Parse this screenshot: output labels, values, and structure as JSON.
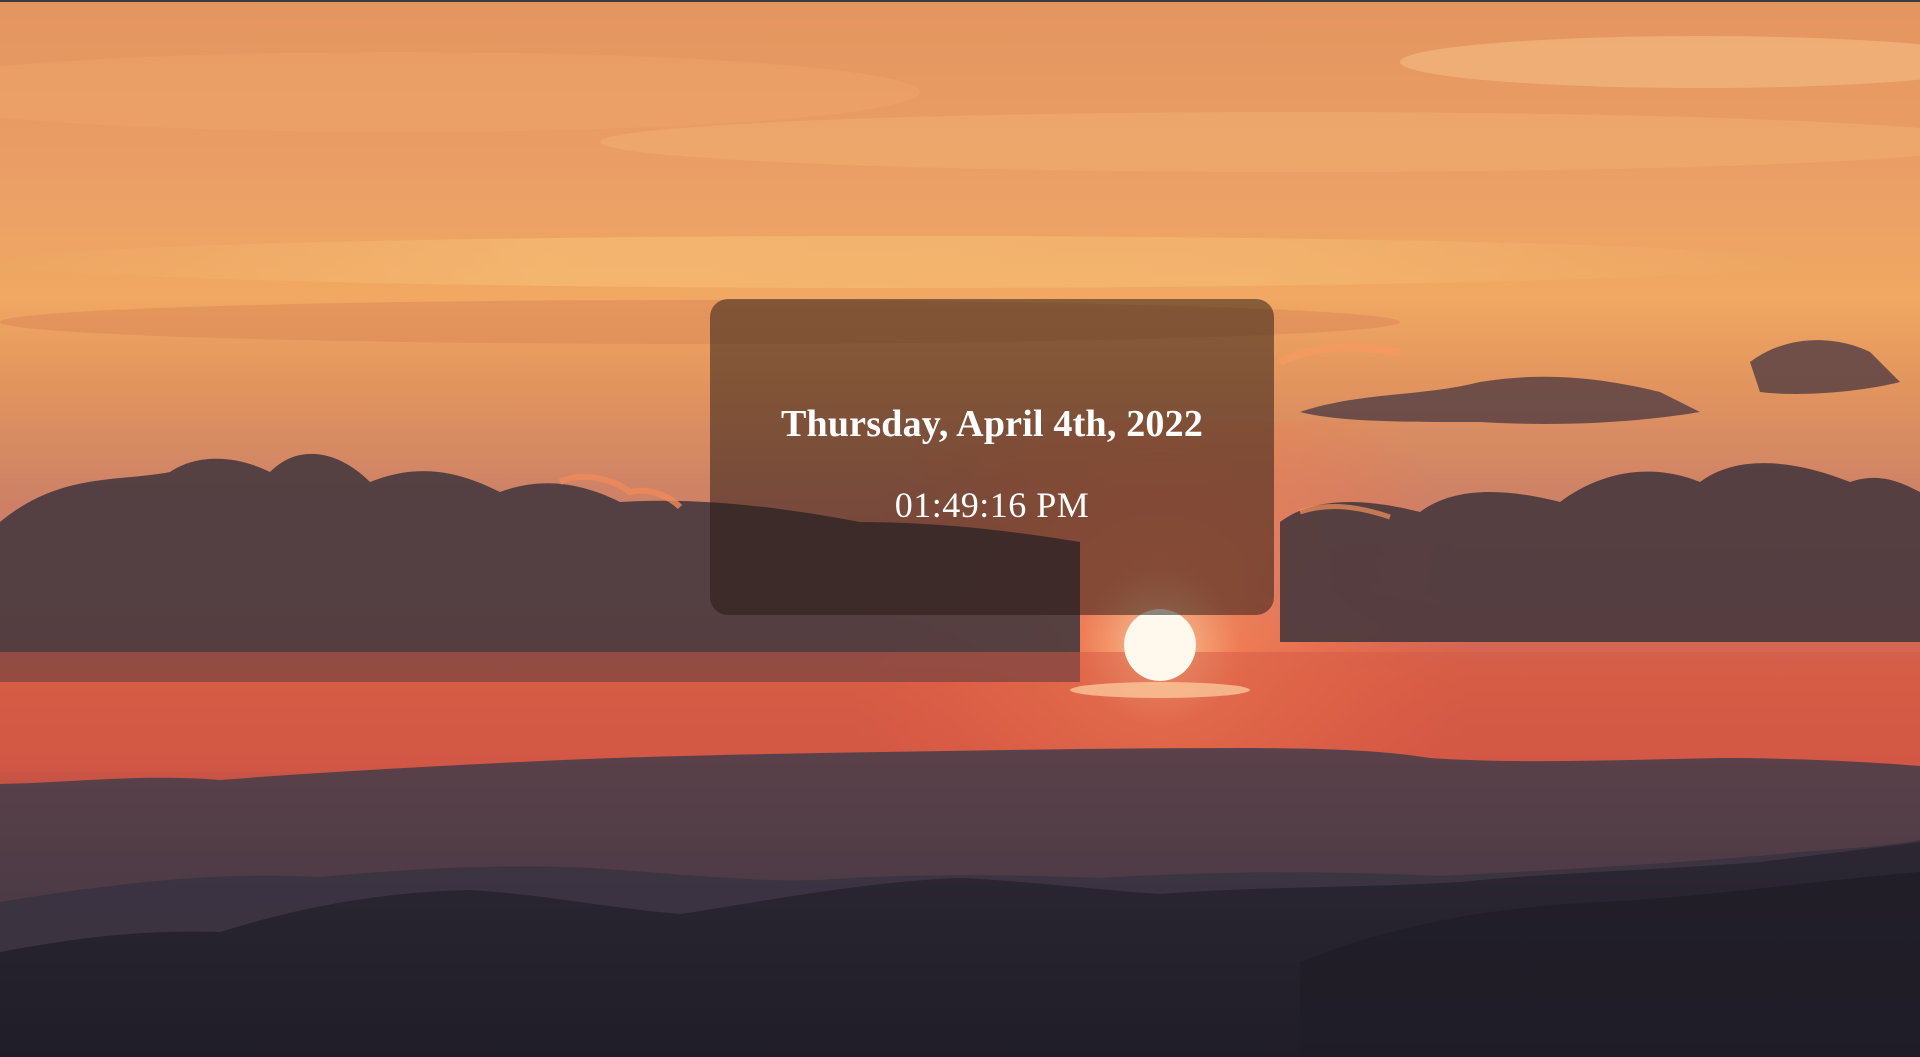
{
  "background": {
    "description_icon": "sunset-mountains-image",
    "colors": {
      "sky_top": "#e99a5c",
      "sky_glow": "#f3b26a",
      "horizon": "#d9563f",
      "sun": "#fff6e8",
      "clouds": "#4b3a3c",
      "hills_far": "#4a3a41",
      "hills_near": "#22202b"
    }
  },
  "clock": {
    "date": "Thursday, April 4th, 2022",
    "time": "01:49:16 PM"
  }
}
